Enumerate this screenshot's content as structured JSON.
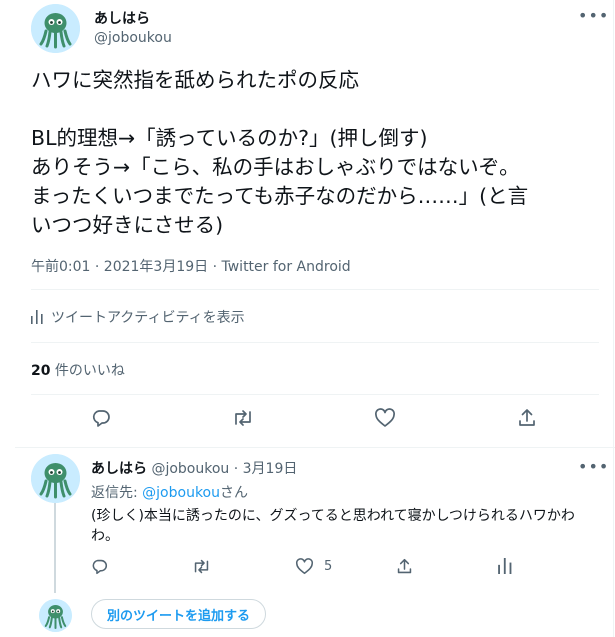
{
  "tweet": {
    "author_name": "あしはら",
    "author_handle": "@joboukou",
    "more_glyph": "•••",
    "lines": [
      "ハワに突然指を舐められたポの反応",
      "",
      "BL的理想→「誘っているのか?」(押し倒す)",
      "ありそう→「こら、私の手はおしゃぶりではないぞ。",
      "まったくいつまでたっても赤子なのだから……」(と言",
      "いつつ好きにさせる)"
    ],
    "meta": "午前0:01 · 2021年3月19日 · Twitter for Android",
    "activity_label": "ツイートアクティビティを表示",
    "likes_count": "20",
    "likes_label": " 件のいいね"
  },
  "reply": {
    "author_name": "あしはら",
    "author_handle": "@joboukou",
    "date": "· 3月19日",
    "reply_to_prefix": "返信先: ",
    "reply_to_handle": "@joboukou",
    "reply_to_suffix": "さん",
    "text_lines": [
      "(珍しく)本当に誘ったのに、グズってると思われて寝かしつけられるハワかわ",
      "わ。"
    ],
    "like_count": "5",
    "more_glyph": "•••"
  },
  "add_tweet_button": "別のツイートを追加する",
  "icons": {
    "avatar": "cthulhu-avatar-icon",
    "reply": "reply-icon",
    "retweet": "retweet-icon",
    "like": "heart-icon",
    "share": "share-icon",
    "activity": "bar-chart-icon",
    "analytics": "analytics-icon"
  },
  "colors": {
    "accent": "#1d9bf0",
    "secondary_text": "#536471",
    "avatar_bg": "#c9ecff",
    "avatar_figure": "#3f8f6b"
  }
}
